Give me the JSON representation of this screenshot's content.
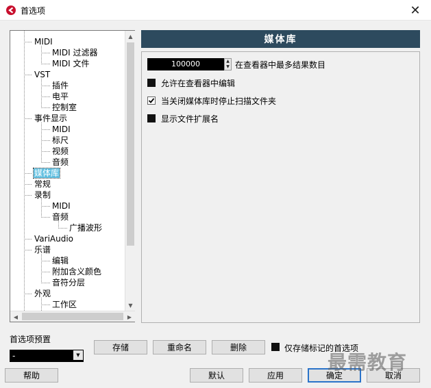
{
  "window": {
    "title": "首选项",
    "close_glyph": "✕"
  },
  "tree": {
    "items": [
      {
        "label": "MIDI",
        "level": 1
      },
      {
        "label": "MIDI 过滤器",
        "level": 2
      },
      {
        "label": "MIDI 文件",
        "level": 2
      },
      {
        "label": "VST",
        "level": 1
      },
      {
        "label": "插件",
        "level": 2
      },
      {
        "label": "电平",
        "level": 2
      },
      {
        "label": "控制室",
        "level": 2
      },
      {
        "label": "事件显示",
        "level": 1
      },
      {
        "label": "MIDI",
        "level": 2
      },
      {
        "label": "标尺",
        "level": 2
      },
      {
        "label": "视频",
        "level": 2
      },
      {
        "label": "音频",
        "level": 2
      },
      {
        "label": "媒体库",
        "level": 1,
        "selected": true
      },
      {
        "label": "常规",
        "level": 1
      },
      {
        "label": "录制",
        "level": 1
      },
      {
        "label": "MIDI",
        "level": 2
      },
      {
        "label": "音频",
        "level": 2
      },
      {
        "label": "广播波形",
        "level": 3
      },
      {
        "label": "VariAudio",
        "level": 1
      },
      {
        "label": "乐谱",
        "level": 1
      },
      {
        "label": "编辑",
        "level": 2
      },
      {
        "label": "附加含义颜色",
        "level": 2
      },
      {
        "label": "音符分层",
        "level": 2
      },
      {
        "label": "外观",
        "level": 1
      },
      {
        "label": "工作区",
        "level": 2
      }
    ]
  },
  "section": {
    "title": "媒体库",
    "max_results_value": "100000",
    "max_results_label": "在查看器中最多结果数目",
    "checks": [
      {
        "label": "允许在查看器中编辑",
        "checked": false
      },
      {
        "label": "当关闭媒体库时停止扫描文件夹",
        "checked": true
      },
      {
        "label": "显示文件扩展名",
        "checked": false
      }
    ]
  },
  "presets": {
    "label": "首选项预置",
    "selected": "-",
    "store": "存储",
    "rename": "重命名",
    "delete": "删除",
    "marked_only_label": "仅存储标记的首选项"
  },
  "footer": {
    "help": "帮助",
    "default": "默认",
    "apply": "应用",
    "ok": "确定",
    "cancel": "取消"
  },
  "watermark": "最需教育",
  "colors": {
    "header_bg": "#2d4a5e",
    "selection": "#60bfe0",
    "default_button_border": "#2a73c9"
  }
}
